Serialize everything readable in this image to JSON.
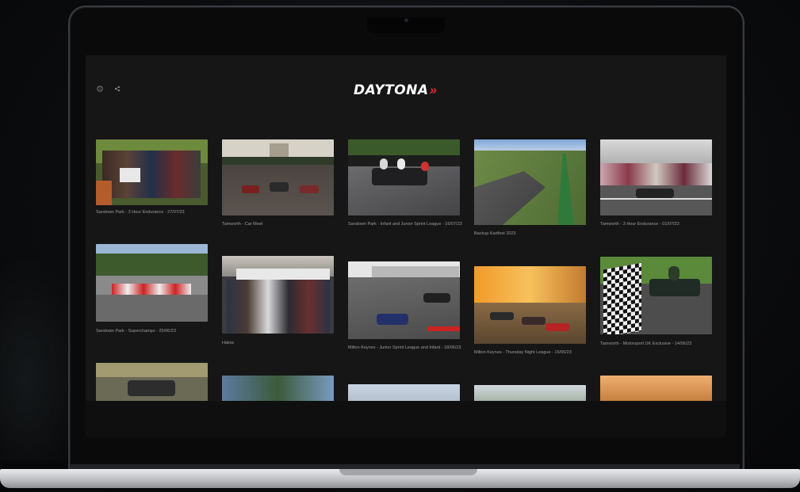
{
  "app": {
    "logo_text": "DAYTONA",
    "logo_mark": "»",
    "accent_color": "#e3262b"
  },
  "toolbar": {
    "icons": [
      "info-icon",
      "share-icon"
    ]
  },
  "gallery": {
    "albums": [
      {
        "title": "Sandown Park - 3 Hour Endurance - 27/07/23"
      },
      {
        "title": "Tamworth - Car Meet"
      },
      {
        "title": "Sandown Park - Infant and Junior Sprint League - 16/07/23"
      },
      {
        "title": "Backup Kartfest 2023"
      },
      {
        "title": "Tamworth - 3 Hour Endurance - 01/07/23"
      },
      {
        "title": "Sandown Park - Superchamps - 25/06/23"
      },
      {
        "title": "Halow"
      },
      {
        "title": "Milton Keynes - Junior Sprint League and Infant - 18/06/23"
      },
      {
        "title": "Milton Keynes - Thursday Night League - 15/06/23"
      },
      {
        "title": "Tamworth - Motorsport UK Exclusive - 14/06/23"
      },
      {
        "title": ""
      },
      {
        "title": ""
      },
      {
        "title": ""
      },
      {
        "title": ""
      },
      {
        "title": ""
      }
    ]
  }
}
